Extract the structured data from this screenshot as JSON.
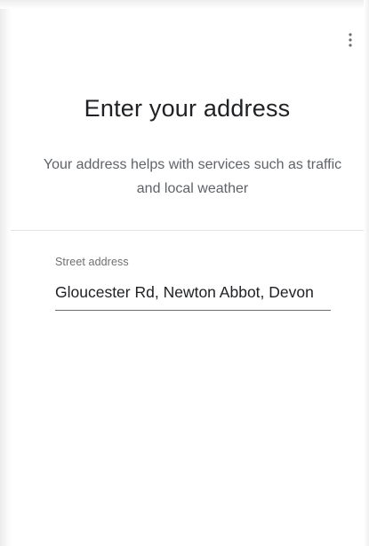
{
  "header": {
    "menu_icon": "more-vert-icon"
  },
  "main": {
    "title": "Enter your address",
    "subtitle": "Your address helps with services such as traffic and local weather"
  },
  "form": {
    "street_label": "Street address",
    "street_value": "Gloucester Rd, Newton Abbot, Devon"
  },
  "colors": {
    "title": "#202124",
    "secondary_text": "#5f6368",
    "divider": "#e3e3e3"
  }
}
